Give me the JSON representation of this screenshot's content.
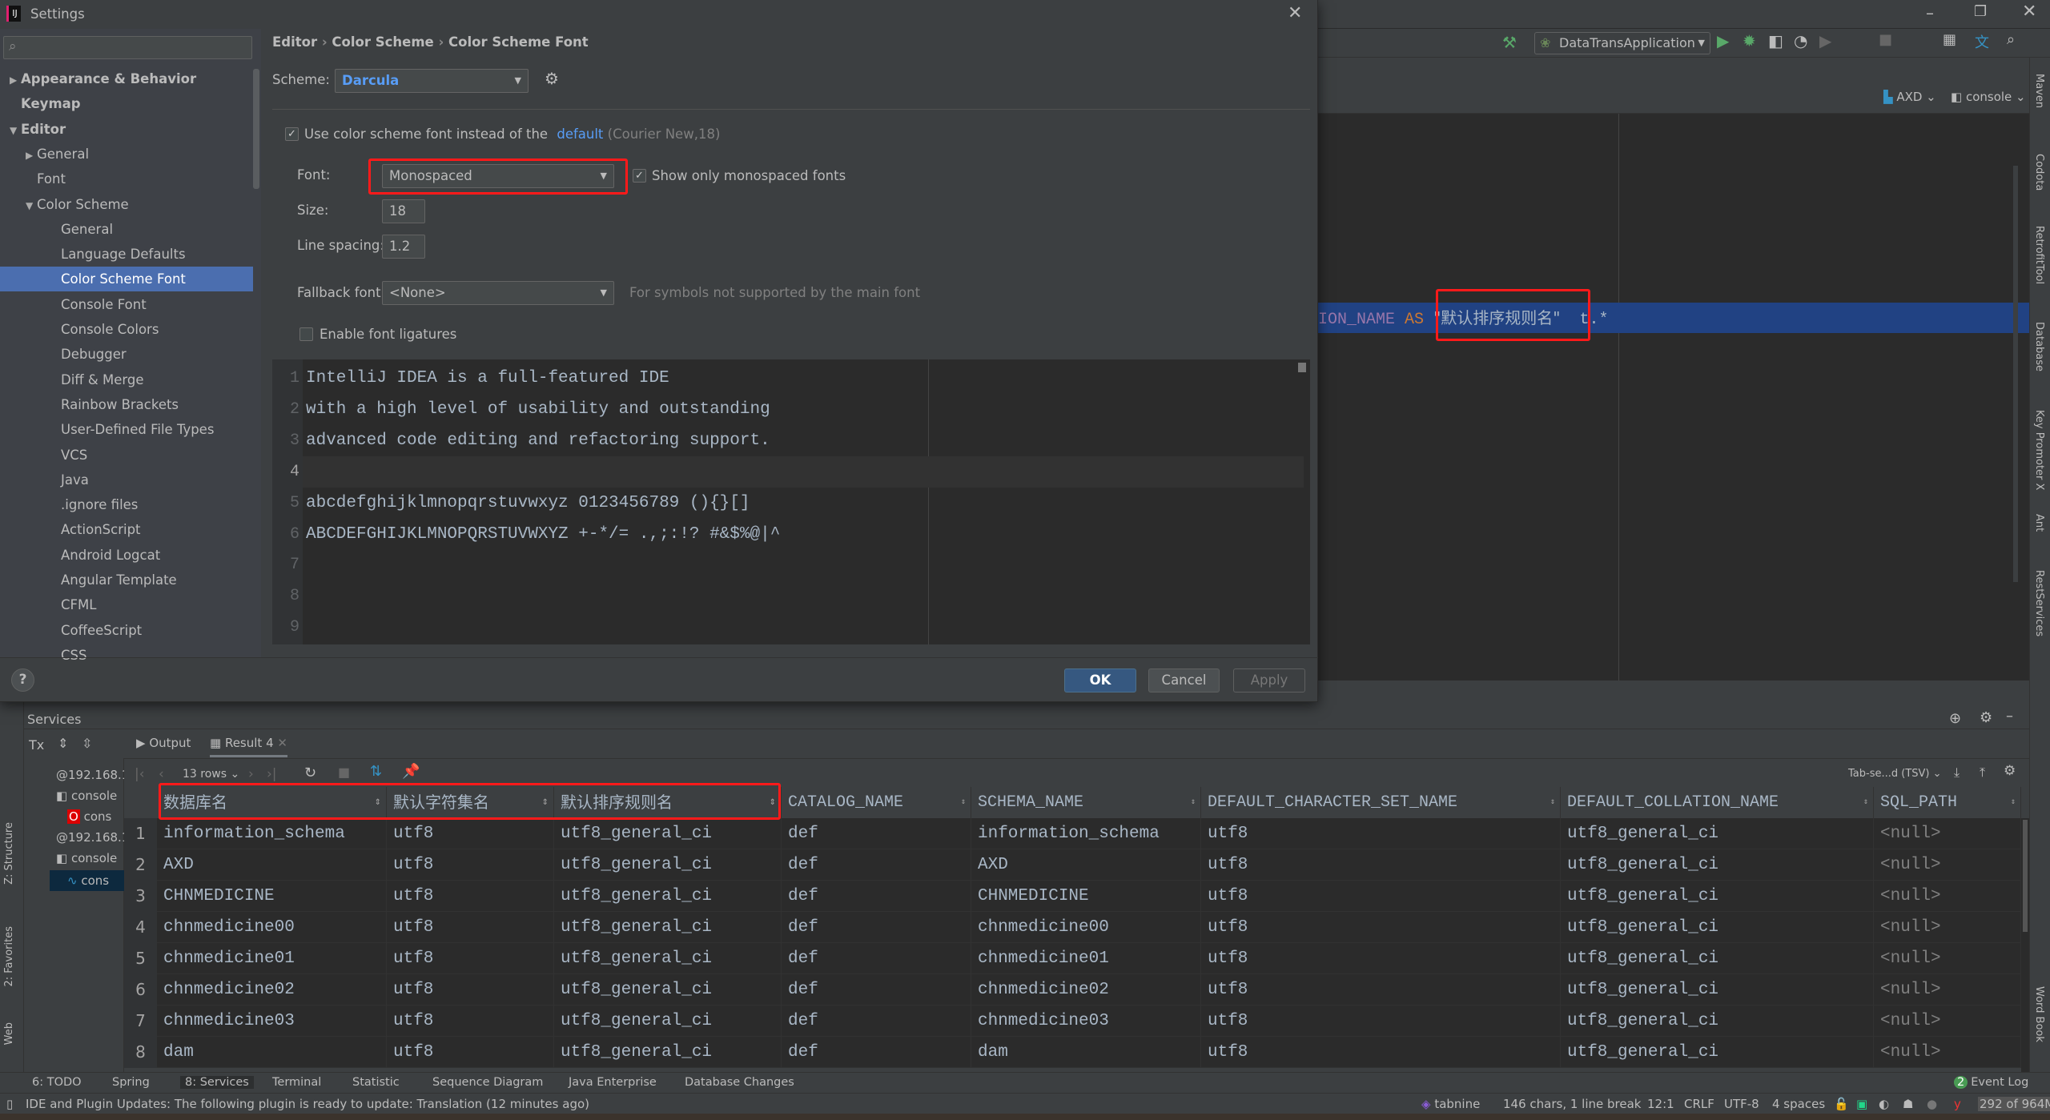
{
  "dialog": {
    "title": "Settings",
    "breadcrumb": [
      "Editor",
      "Color Scheme",
      "Color Scheme Font"
    ],
    "scheme_label": "Scheme:",
    "scheme_value": "Darcula",
    "use_scheme_font_label": "Use color scheme font instead of the",
    "use_scheme_font_checked": true,
    "default_link": "default",
    "default_info": "(Courier New,18)",
    "font_label": "Font:",
    "font_value": "Monospaced",
    "show_mono_label": "Show only monospaced fonts",
    "show_mono_checked": true,
    "size_label": "Size:",
    "size_value": "18",
    "line_spacing_label": "Line spacing:",
    "line_spacing_value": "1.2",
    "fallback_label": "Fallback font:",
    "fallback_value": "<None>",
    "fallback_hint": "For symbols not supported by the main font",
    "ligatures_label": "Enable font ligatures",
    "ligatures_checked": false,
    "preview_lines": [
      "IntelliJ IDEA is a full-featured IDE",
      "with a high level of usability and outstanding",
      "advanced code editing and refactoring support.",
      "",
      "abcdefghijklmnopqrstuvwxyz 0123456789 (){}[]",
      "ABCDEFGHIJKLMNOPQRSTUVWXYZ +-*/= .,;:!? #&$%@|^",
      "",
      "",
      ""
    ],
    "ok_label": "OK",
    "cancel_label": "Cancel",
    "apply_label": "Apply",
    "help_label": "?",
    "sidebar": [
      {
        "label": "Appearance & Behavior",
        "level": 0,
        "arrow": "right",
        "bold": true
      },
      {
        "label": "Keymap",
        "level": 0,
        "bold": true
      },
      {
        "label": "Editor",
        "level": 0,
        "arrow": "down",
        "bold": true
      },
      {
        "label": "General",
        "level": 1,
        "arrow": "right"
      },
      {
        "label": "Font",
        "level": 1
      },
      {
        "label": "Color Scheme",
        "level": 1,
        "arrow": "down"
      },
      {
        "label": "General",
        "level": 2
      },
      {
        "label": "Language Defaults",
        "level": 2
      },
      {
        "label": "Color Scheme Font",
        "level": 2,
        "selected": true
      },
      {
        "label": "Console Font",
        "level": 2
      },
      {
        "label": "Console Colors",
        "level": 2
      },
      {
        "label": "Debugger",
        "level": 2
      },
      {
        "label": "Diff & Merge",
        "level": 2
      },
      {
        "label": "Rainbow Brackets",
        "level": 2
      },
      {
        "label": "User-Defined File Types",
        "level": 2
      },
      {
        "label": "VCS",
        "level": 2
      },
      {
        "label": "Java",
        "level": 2
      },
      {
        "label": ".ignore files",
        "level": 2
      },
      {
        "label": "ActionScript",
        "level": 2
      },
      {
        "label": "Android Logcat",
        "level": 2
      },
      {
        "label": "Angular Template",
        "level": 2
      },
      {
        "label": "CFML",
        "level": 2
      },
      {
        "label": "CoffeeScript",
        "level": 2
      },
      {
        "label": "CSS",
        "level": 2
      }
    ]
  },
  "ide": {
    "run_config": "DataTransApplication",
    "datasource": "AXD",
    "console": "console",
    "editor_line": {
      "prefix": "ION_NAME",
      "keyword": "AS",
      "string": "\"默认排序规则名\"",
      "suffix": "t.*"
    },
    "right_tools": [
      "Maven",
      "Codota",
      "RetrofitTool",
      "Database",
      "Key Promoter X",
      "Ant",
      "RestServices",
      "Word Book"
    ],
    "left_tools": [
      "Z: Structure",
      "2: Favorites",
      "Web"
    ]
  },
  "services": {
    "title": "Services",
    "tx_label": "Tx",
    "tree": [
      "@192.168.1",
      "console",
      "cons",
      "@192.168.1",
      "console",
      "cons"
    ],
    "tabs": [
      {
        "label": "Output"
      },
      {
        "label": "Result 4",
        "active": true
      }
    ],
    "rows_label": "13 rows",
    "export_format": "Tab-se...d (TSV)",
    "columns": [
      "数据库名",
      "默认字符集名",
      "默认排序规则名",
      "CATALOG_NAME",
      "SCHEMA_NAME",
      "DEFAULT_CHARACTER_SET_NAME",
      "DEFAULT_COLLATION_NAME",
      "SQL_PATH"
    ],
    "rows": [
      [
        "information_schema",
        "utf8",
        "utf8_general_ci",
        "def",
        "information_schema",
        "utf8",
        "utf8_general_ci",
        "<null>"
      ],
      [
        "AXD",
        "utf8",
        "utf8_general_ci",
        "def",
        "AXD",
        "utf8",
        "utf8_general_ci",
        "<null>"
      ],
      [
        "CHNMEDICINE",
        "utf8",
        "utf8_general_ci",
        "def",
        "CHNMEDICINE",
        "utf8",
        "utf8_general_ci",
        "<null>"
      ],
      [
        "chnmedicine00",
        "utf8",
        "utf8_general_ci",
        "def",
        "chnmedicine00",
        "utf8",
        "utf8_general_ci",
        "<null>"
      ],
      [
        "chnmedicine01",
        "utf8",
        "utf8_general_ci",
        "def",
        "chnmedicine01",
        "utf8",
        "utf8_general_ci",
        "<null>"
      ],
      [
        "chnmedicine02",
        "utf8",
        "utf8_general_ci",
        "def",
        "chnmedicine02",
        "utf8",
        "utf8_general_ci",
        "<null>"
      ],
      [
        "chnmedicine03",
        "utf8",
        "utf8_general_ci",
        "def",
        "chnmedicine03",
        "utf8",
        "utf8_general_ci",
        "<null>"
      ],
      [
        "dam",
        "utf8",
        "utf8_general_ci",
        "def",
        "dam",
        "utf8",
        "utf8_general_ci",
        "<null>"
      ]
    ]
  },
  "bottom_tools": [
    "6: TODO",
    "Spring",
    "8: Services",
    "Terminal",
    "Statistic",
    "Sequence Diagram",
    "Java Enterprise",
    "Database Changes"
  ],
  "event_log": {
    "label": "Event Log",
    "count": "2"
  },
  "status": {
    "message": "IDE and Plugin Updates: The following plugin is ready to update: Translation (12 minutes ago)",
    "tabnine": "tabnine",
    "selection": "146 chars, 1 line break",
    "position": "12:1",
    "line_sep": "CRLF",
    "encoding": "UTF-8",
    "indent": "4 spaces",
    "memory": "292 of 964M"
  },
  "colors": {
    "accent": "#4b6eaf",
    "link": "#589df6",
    "highlight_box": "#ff1a1a",
    "selection_line": "#214283"
  }
}
